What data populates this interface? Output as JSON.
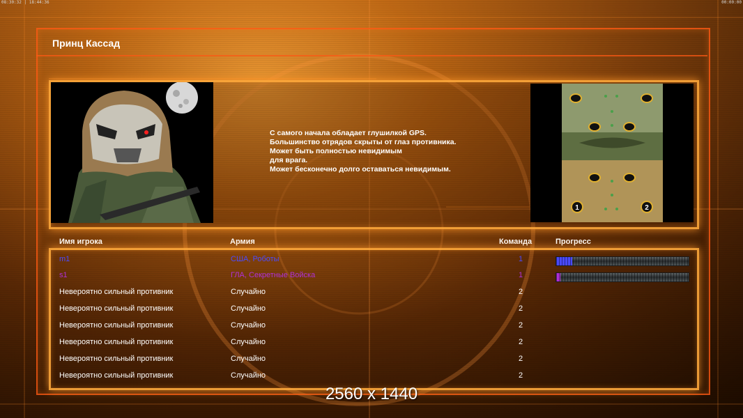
{
  "status_bar": {
    "left": "08:30:32 | 18:44:36",
    "right": "00:00:00"
  },
  "title": "Принц Кассад",
  "description": [
    "С самого начала обладает глушилкой GPS.",
    "Большинство отрядов скрыты от глаз противника.",
    "Может быть полностью невидимым",
    "для врага.",
    "Может бесконечно долго оставаться невидимым."
  ],
  "minimap": {
    "slots": [
      "1",
      "2"
    ]
  },
  "table": {
    "headers": {
      "name": "Имя игрока",
      "army": "Армия",
      "team": "Команда",
      "progress": "Прогресс"
    },
    "rows": [
      {
        "name": "m1",
        "army": "США, Роботы",
        "team": "1",
        "color": "#4a4aff",
        "progress": 0.12
      },
      {
        "name": "s1",
        "army": "ГЛА, Секретные Войска",
        "team": "1",
        "color": "#b030d8",
        "progress": 0.03
      },
      {
        "name": "Невероятно сильный противник",
        "army": "Случайно",
        "team": "2",
        "color": "#ffffff"
      },
      {
        "name": "Невероятно сильный противник",
        "army": "Случайно",
        "team": "2",
        "color": "#ffffff"
      },
      {
        "name": "Невероятно сильный противник",
        "army": "Случайно",
        "team": "2",
        "color": "#ffffff"
      },
      {
        "name": "Невероятно сильный противник",
        "army": "Случайно",
        "team": "2",
        "color": "#ffffff"
      },
      {
        "name": "Невероятно сильный противник",
        "army": "Случайно",
        "team": "2",
        "color": "#ffffff"
      },
      {
        "name": "Невероятно сильный противник",
        "army": "Случайно",
        "team": "2",
        "color": "#ffffff"
      }
    ]
  },
  "resolution_label": "2560 x 1440"
}
